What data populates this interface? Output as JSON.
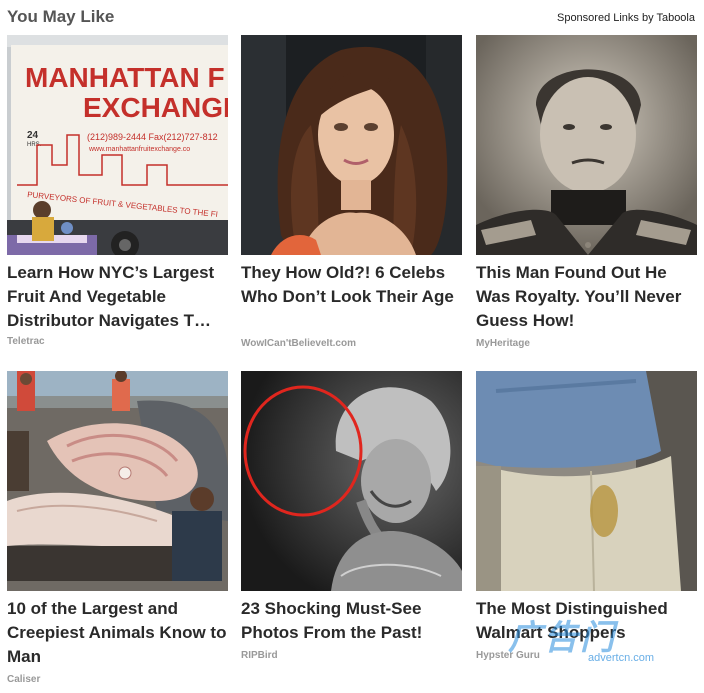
{
  "header": {
    "title": "You May Like",
    "sponsored": "Sponsored Links by Taboola"
  },
  "cards": [
    {
      "headline": "Learn How NYC’s Largest Fruit And Vegetable Distributor Navigates T…",
      "source": "Teletrac",
      "image": "produce-truck"
    },
    {
      "headline": "They How Old?! 6 Celebs Who Don’t Look Their Age",
      "source": "WowICan'tBelieveIt.com",
      "image": "woman-portrait"
    },
    {
      "headline": "This Man Found Out He Was Royalty. You’ll Never Guess How!",
      "source": "MyHeritage",
      "image": "vintage-portrait"
    },
    {
      "headline": "10 of the Largest and Creepiest Animals Know to Man",
      "source": "Caliser",
      "image": "large-fish"
    },
    {
      "headline": "23 Shocking Must-See Photos From the Past!",
      "source": "RIPBird",
      "image": "vintage-photo"
    },
    {
      "headline": "The Most Distinguished Walmart Shoppers",
      "source": "Hypster Guru",
      "image": "shopper"
    }
  ],
  "thumb_text": {
    "truck_line1": "MANHATTAN F",
    "truck_line2": "EXCHANGE",
    "truck_hours": "24",
    "truck_hrs": "HRS.",
    "truck_phone": "(212)989-2444 Fax(212)727-812",
    "truck_url": "www.manhattanfruitexchange.co",
    "truck_tag": "PURVEYORS OF FRUIT & VEGETABLES TO THE FI"
  },
  "watermark": {
    "big": "广告门",
    "small": "advertcn.com"
  }
}
